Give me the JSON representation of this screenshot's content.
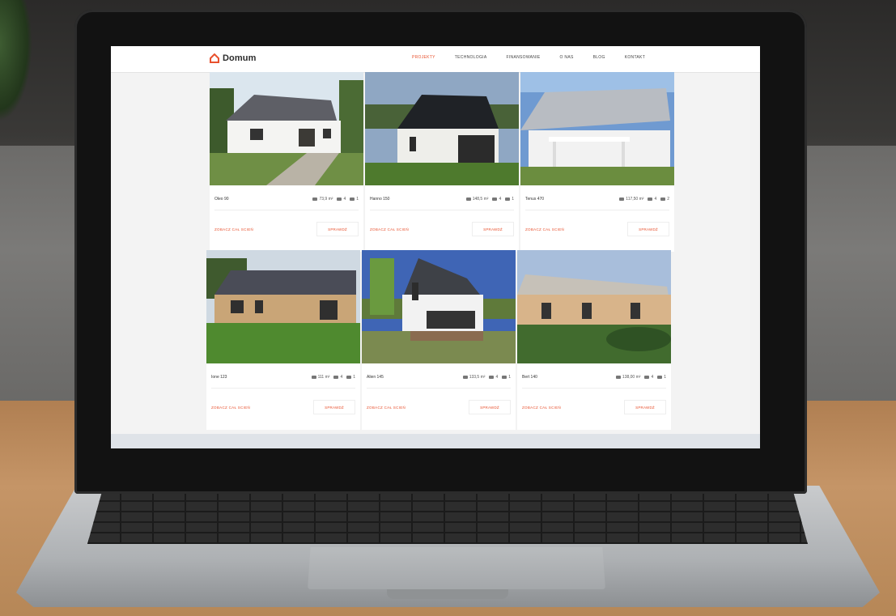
{
  "site": {
    "logo_text": "Domum",
    "nav": [
      {
        "label": "PROJEKTY",
        "active": true
      },
      {
        "label": "TECHNOLOGIA",
        "active": false
      },
      {
        "label": "FINANSOWANIE",
        "active": false
      },
      {
        "label": "O NAS",
        "active": false
      },
      {
        "label": "BLOG",
        "active": false
      },
      {
        "label": "KONTAKT",
        "active": false
      }
    ],
    "accent": "#e8512e"
  },
  "cards": [
    {
      "name": "Oleo 90",
      "area": "73,9 m²",
      "rooms": "4",
      "baths": "1",
      "link": "ZOBACZ CAŁ SCIEŃ",
      "button": "SPRAWDŹ"
    },
    {
      "name": "Hanno 150",
      "area": "148,5 m²",
      "rooms": "4",
      "baths": "1",
      "link": "ZOBACZ CAŁ SCIEŃ",
      "button": "SPRAWDŹ"
    },
    {
      "name": "Tenus 470",
      "area": "117,50 m²",
      "rooms": "4",
      "baths": "2",
      "link": "ZOBACZ CAŁ SCIEŃ",
      "button": "SPRAWDŹ"
    },
    {
      "name": "Ione 123",
      "area": "111 m²",
      "rooms": "4",
      "baths": "1",
      "link": "ZOBACZ CAŁ SCIEŃ",
      "button": "SPRAWDŹ"
    },
    {
      "name": "Alien 145",
      "area": "133,5 m²",
      "rooms": "4",
      "baths": "1",
      "link": "ZOBACZ CAŁ SCIEŃ",
      "button": "SPRAWDŹ"
    },
    {
      "name": "Bert 140",
      "area": "138,00 m²",
      "rooms": "4",
      "baths": "1",
      "link": "ZOBACZ CAŁ SCIEŃ",
      "button": "SPRAWDŹ"
    }
  ]
}
